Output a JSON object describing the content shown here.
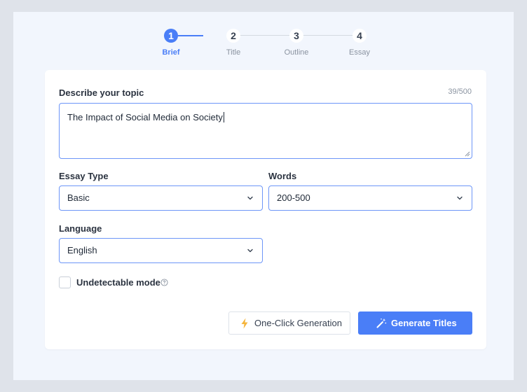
{
  "stepper": {
    "steps": [
      {
        "number": "1",
        "label": "Brief"
      },
      {
        "number": "2",
        "label": "Title"
      },
      {
        "number": "3",
        "label": "Outline"
      },
      {
        "number": "4",
        "label": "Essay"
      }
    ],
    "active_step": 1
  },
  "form": {
    "topic_label": "Describe your topic",
    "topic_counter": "39/500",
    "topic_value": "The Impact of Social Media on Society",
    "essay_type_label": "Essay Type",
    "essay_type_value": "Basic",
    "words_label": "Words",
    "words_value": "200-500",
    "language_label": "Language",
    "language_value": "English",
    "undetectable_label": "Undetectable mode",
    "undetectable_checked": false
  },
  "actions": {
    "one_click_label": "One-Click Generation",
    "generate_label": "Generate Titles"
  },
  "colors": {
    "accent": "#4a7ef7",
    "bolt": "#f5b53d",
    "page_bg": "#dfe3ea",
    "panel_bg": "#f2f6fd"
  },
  "icons": [
    "chevron-down-icon",
    "help-circle-icon",
    "lightning-bolt-icon",
    "magic-wand-icon",
    "resize-handle-icon"
  ]
}
